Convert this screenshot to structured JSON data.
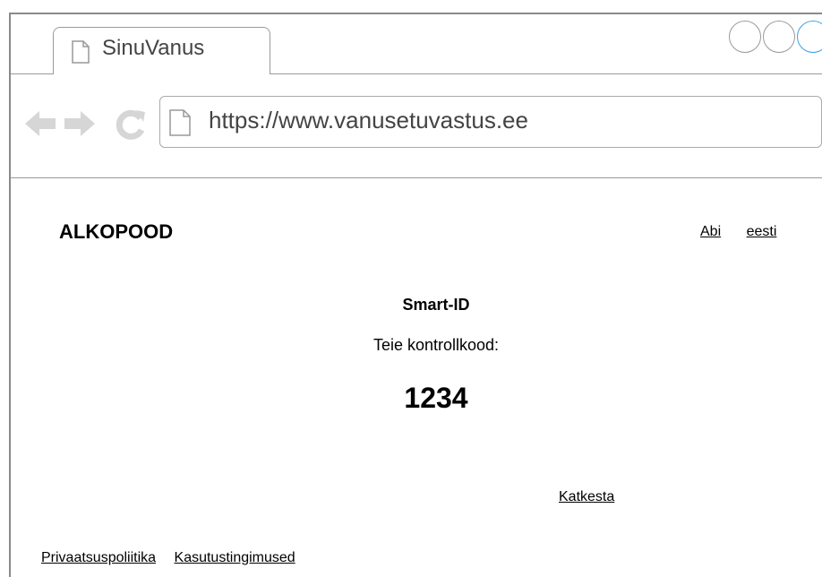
{
  "browser": {
    "tab_title": "SinuVanus",
    "url": "https://www.vanusetuvastus.ee",
    "icons": [
      "document-icon",
      "back-arrow-icon",
      "forward-arrow-icon",
      "reload-icon"
    ],
    "accent_color": "#3aa1e6"
  },
  "page": {
    "brand": "ALKOPOOD",
    "links": {
      "help": "Abi",
      "language": "eesti"
    },
    "method_title": "Smart-ID",
    "code_prompt": "Teie kontrollkood:",
    "control_code": "1234",
    "cancel_label": "Katkesta"
  },
  "footer": {
    "privacy_label": "Privaatsuspoliitika",
    "terms_label": "Kasutustingimused"
  }
}
